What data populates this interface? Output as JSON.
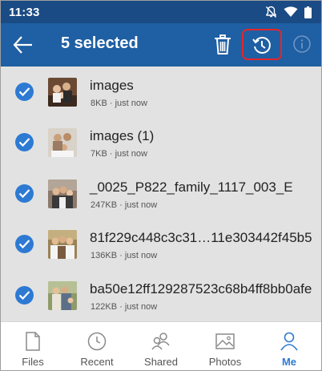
{
  "status_bar": {
    "time": "11:33"
  },
  "app_bar": {
    "title": "5 selected"
  },
  "files": [
    {
      "name": "images",
      "size": "8KB",
      "time": "just now"
    },
    {
      "name": "images (1)",
      "size": "7KB",
      "time": "just now"
    },
    {
      "name": "_0025_P822_family_1117_003_E",
      "size": "247KB",
      "time": "just now"
    },
    {
      "name": "81f229c448c3c31…11e303442f45b5",
      "size": "136KB",
      "time": "just now"
    },
    {
      "name": "ba50e12ff129287523c68b4ff8bb0afe",
      "size": "122KB",
      "time": "just now"
    }
  ],
  "meta_separator": " · ",
  "nav": [
    {
      "label": "Files",
      "icon": "file-icon"
    },
    {
      "label": "Recent",
      "icon": "clock-icon"
    },
    {
      "label": "Shared",
      "icon": "people-icon"
    },
    {
      "label": "Photos",
      "icon": "image-icon"
    },
    {
      "label": "Me",
      "icon": "person-icon",
      "active": true
    }
  ],
  "colors": {
    "status_bar": "#1a4b84",
    "app_bar": "#1f5fa3",
    "accent": "#2d7ad3",
    "highlight": "#e3262b",
    "list_bg": "#e2e2e2"
  }
}
